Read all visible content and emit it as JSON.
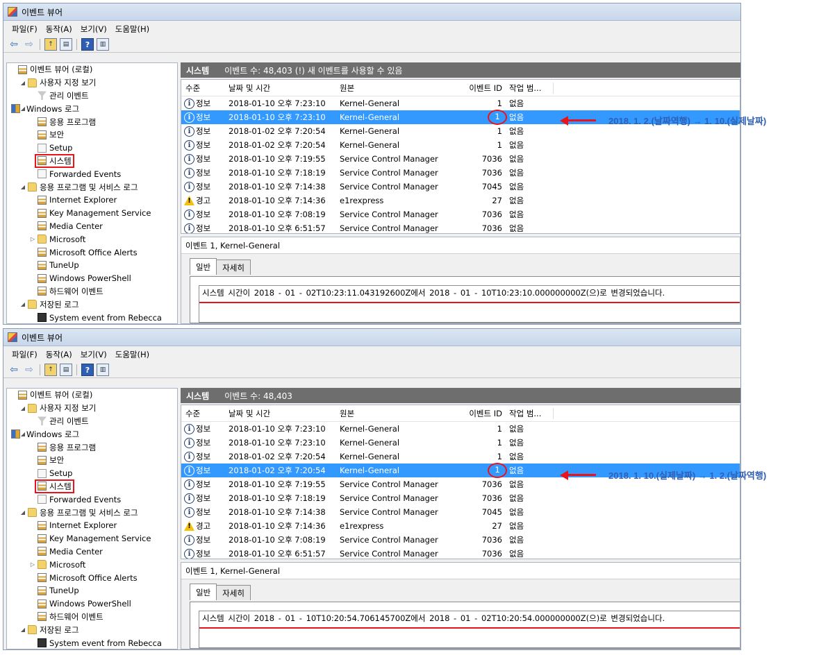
{
  "windows": [
    {
      "title": "이벤트 뷰어",
      "menu": [
        "파일(F)",
        "동작(A)",
        "보기(V)",
        "도움말(H)"
      ],
      "tree": [
        {
          "label": "이벤트 뷰어 (로컬)",
          "indent": 0,
          "icon": "log",
          "exp": ""
        },
        {
          "label": "사용자 지정 보기",
          "indent": 1,
          "icon": "folder",
          "exp": "◢"
        },
        {
          "label": "관리 이벤트",
          "indent": 2,
          "icon": "filter",
          "exp": ""
        },
        {
          "label": "Windows 로그",
          "indent": 1,
          "icon": "win",
          "exp": "◢"
        },
        {
          "label": "응용 프로그램",
          "indent": 2,
          "icon": "log",
          "exp": ""
        },
        {
          "label": "보안",
          "indent": 2,
          "icon": "log",
          "exp": ""
        },
        {
          "label": "Setup",
          "indent": 2,
          "icon": "plain",
          "exp": ""
        },
        {
          "label": "시스템",
          "indent": 2,
          "icon": "log",
          "exp": "",
          "highlight": true
        },
        {
          "label": "Forwarded Events",
          "indent": 2,
          "icon": "plain",
          "exp": ""
        },
        {
          "label": "응용 프로그램 및 서비스 로그",
          "indent": 1,
          "icon": "folder",
          "exp": "◢"
        },
        {
          "label": "Internet Explorer",
          "indent": 2,
          "icon": "log",
          "exp": ""
        },
        {
          "label": "Key Management Service",
          "indent": 2,
          "icon": "log",
          "exp": ""
        },
        {
          "label": "Media Center",
          "indent": 2,
          "icon": "log",
          "exp": ""
        },
        {
          "label": "Microsoft",
          "indent": 2,
          "icon": "folder",
          "exp": "▷"
        },
        {
          "label": "Microsoft Office Alerts",
          "indent": 2,
          "icon": "log",
          "exp": ""
        },
        {
          "label": "TuneUp",
          "indent": 2,
          "icon": "log",
          "exp": ""
        },
        {
          "label": "Windows PowerShell",
          "indent": 2,
          "icon": "log",
          "exp": ""
        },
        {
          "label": "하드웨어 이벤트",
          "indent": 2,
          "icon": "log",
          "exp": ""
        },
        {
          "label": "저장된 로그",
          "indent": 1,
          "icon": "folder",
          "exp": "◢"
        },
        {
          "label": "System event from Rebecca",
          "indent": 2,
          "icon": "disk",
          "exp": ""
        }
      ],
      "header_title": "시스템",
      "header_info": "이벤트 수: 48,403 (!) 새 이벤트를 사용할 수 있음",
      "columns": [
        "수준",
        "날짜 및 시간",
        "원본",
        "이벤트 ID",
        "작업 범..."
      ],
      "selected_row": 1,
      "rows": [
        {
          "level": "정보",
          "type": "info",
          "date": "2018-01-10 오후 7:23:10",
          "source": "Kernel-General",
          "id": "1",
          "task": "없음"
        },
        {
          "level": "정보",
          "type": "info",
          "date": "2018-01-10 오후 7:23:10",
          "source": "Kernel-General",
          "id": "1",
          "task": "없음"
        },
        {
          "level": "정보",
          "type": "info",
          "date": "2018-01-02 오후 7:20:54",
          "source": "Kernel-General",
          "id": "1",
          "task": "없음"
        },
        {
          "level": "정보",
          "type": "info",
          "date": "2018-01-02 오후 7:20:54",
          "source": "Kernel-General",
          "id": "1",
          "task": "없음"
        },
        {
          "level": "정보",
          "type": "info",
          "date": "2018-01-10 오후 7:19:55",
          "source": "Service Control Manager",
          "id": "7036",
          "task": "없음"
        },
        {
          "level": "정보",
          "type": "info",
          "date": "2018-01-10 오후 7:18:19",
          "source": "Service Control Manager",
          "id": "7036",
          "task": "없음"
        },
        {
          "level": "정보",
          "type": "info",
          "date": "2018-01-10 오후 7:14:38",
          "source": "Service Control Manager",
          "id": "7045",
          "task": "없음"
        },
        {
          "level": "경고",
          "type": "warn",
          "date": "2018-01-10 오후 7:14:36",
          "source": "e1rexpress",
          "id": "27",
          "task": "없음"
        },
        {
          "level": "정보",
          "type": "info",
          "date": "2018-01-10 오후 7:08:19",
          "source": "Service Control Manager",
          "id": "7036",
          "task": "없음"
        },
        {
          "level": "정보",
          "type": "info",
          "date": "2018-01-10 오후 6:51:57",
          "source": "Service Control Manager",
          "id": "7036",
          "task": "없음"
        }
      ],
      "detail_title": "이벤트 1, Kernel-General",
      "tabs": [
        "일반",
        "자세히"
      ],
      "message": "시스템 시간이   2018  -  01  -  02T10:23:11.043192600Z에서   2018  -  01  -  10T10:23:10.000000000Z(으)로 변경되었습니다.",
      "annotation": "2018. 1. 2.(날짜역행) → 1. 10.(실제날짜)"
    },
    {
      "title": "이벤트 뷰어",
      "menu": [
        "파일(F)",
        "동작(A)",
        "보기(V)",
        "도움말(H)"
      ],
      "tree": [
        {
          "label": "이벤트 뷰어 (로컬)",
          "indent": 0,
          "icon": "log",
          "exp": ""
        },
        {
          "label": "사용자 지정 보기",
          "indent": 1,
          "icon": "folder",
          "exp": "◢"
        },
        {
          "label": "관리 이벤트",
          "indent": 2,
          "icon": "filter",
          "exp": ""
        },
        {
          "label": "Windows 로그",
          "indent": 1,
          "icon": "win",
          "exp": "◢"
        },
        {
          "label": "응용 프로그램",
          "indent": 2,
          "icon": "log",
          "exp": ""
        },
        {
          "label": "보안",
          "indent": 2,
          "icon": "log",
          "exp": ""
        },
        {
          "label": "Setup",
          "indent": 2,
          "icon": "plain",
          "exp": ""
        },
        {
          "label": "시스템",
          "indent": 2,
          "icon": "log",
          "exp": "",
          "highlight": true
        },
        {
          "label": "Forwarded Events",
          "indent": 2,
          "icon": "plain",
          "exp": ""
        },
        {
          "label": "응용 프로그램 및 서비스 로그",
          "indent": 1,
          "icon": "folder",
          "exp": "◢"
        },
        {
          "label": "Internet Explorer",
          "indent": 2,
          "icon": "log",
          "exp": ""
        },
        {
          "label": "Key Management Service",
          "indent": 2,
          "icon": "log",
          "exp": ""
        },
        {
          "label": "Media Center",
          "indent": 2,
          "icon": "log",
          "exp": ""
        },
        {
          "label": "Microsoft",
          "indent": 2,
          "icon": "folder",
          "exp": "▷"
        },
        {
          "label": "Microsoft Office Alerts",
          "indent": 2,
          "icon": "log",
          "exp": ""
        },
        {
          "label": "TuneUp",
          "indent": 2,
          "icon": "log",
          "exp": ""
        },
        {
          "label": "Windows PowerShell",
          "indent": 2,
          "icon": "log",
          "exp": ""
        },
        {
          "label": "하드웨어 이벤트",
          "indent": 2,
          "icon": "log",
          "exp": ""
        },
        {
          "label": "저장된 로그",
          "indent": 1,
          "icon": "folder",
          "exp": "◢"
        },
        {
          "label": "System event from Rebecca",
          "indent": 2,
          "icon": "disk",
          "exp": ""
        }
      ],
      "header_title": "시스템",
      "header_info": "이벤트 수: 48,403",
      "columns": [
        "수준",
        "날짜 및 시간",
        "원본",
        "이벤트 ID",
        "작업 범..."
      ],
      "selected_row": 3,
      "rows": [
        {
          "level": "정보",
          "type": "info",
          "date": "2018-01-10 오후 7:23:10",
          "source": "Kernel-General",
          "id": "1",
          "task": "없음"
        },
        {
          "level": "정보",
          "type": "info",
          "date": "2018-01-10 오후 7:23:10",
          "source": "Kernel-General",
          "id": "1",
          "task": "없음"
        },
        {
          "level": "정보",
          "type": "info",
          "date": "2018-01-02 오후 7:20:54",
          "source": "Kernel-General",
          "id": "1",
          "task": "없음"
        },
        {
          "level": "정보",
          "type": "info",
          "date": "2018-01-02 오후 7:20:54",
          "source": "Kernel-General",
          "id": "1",
          "task": "없음"
        },
        {
          "level": "정보",
          "type": "info",
          "date": "2018-01-10 오후 7:19:55",
          "source": "Service Control Manager",
          "id": "7036",
          "task": "없음"
        },
        {
          "level": "정보",
          "type": "info",
          "date": "2018-01-10 오후 7:18:19",
          "source": "Service Control Manager",
          "id": "7036",
          "task": "없음"
        },
        {
          "level": "정보",
          "type": "info",
          "date": "2018-01-10 오후 7:14:38",
          "source": "Service Control Manager",
          "id": "7045",
          "task": "없음"
        },
        {
          "level": "경고",
          "type": "warn",
          "date": "2018-01-10 오후 7:14:36",
          "source": "e1rexpress",
          "id": "27",
          "task": "없음"
        },
        {
          "level": "정보",
          "type": "info",
          "date": "2018-01-10 오후 7:08:19",
          "source": "Service Control Manager",
          "id": "7036",
          "task": "없음"
        },
        {
          "level": "정보",
          "type": "info",
          "date": "2018-01-10 오후 6:51:57",
          "source": "Service Control Manager",
          "id": "7036",
          "task": "없음"
        }
      ],
      "detail_title": "이벤트 1, Kernel-General",
      "tabs": [
        "일반",
        "자세히"
      ],
      "message": "시스템 시간이   2018  -  01  -  10T10:20:54.706145700Z에서   2018  -  01  -  02T10:20:54.000000000Z(으)로 변경되었습니다.",
      "annotation": "2018. 1. 10.(실제날짜) → 1. 2.(날짜역행)"
    }
  ],
  "colors": {
    "highlight_red": "#e8141c",
    "selection_blue": "#3399ff",
    "annotation_blue": "#2f5fb3",
    "header_gray": "#6e6e6e"
  }
}
